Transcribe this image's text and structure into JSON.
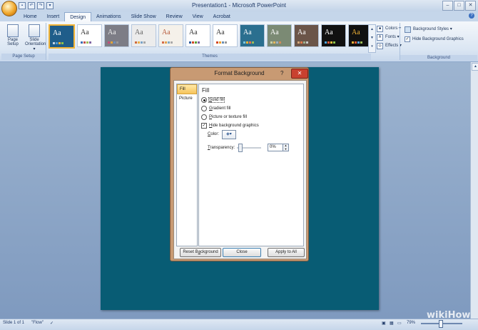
{
  "window": {
    "title": "Presentation1 - Microsoft PowerPoint"
  },
  "qat": {
    "save_icon": "save-icon",
    "undo_icon": "undo-icon",
    "redo_icon": "redo-icon",
    "customize_icon": "customize-qat-icon"
  },
  "window_controls": {
    "minimize": "–",
    "maximize": "□",
    "close": "✕"
  },
  "tabs": [
    "Home",
    "Insert",
    "Design",
    "Animations",
    "Slide Show",
    "Review",
    "View",
    "Acrobat"
  ],
  "active_tab": "Design",
  "ribbon": {
    "page_setup": {
      "label": "Page Setup",
      "page_setup_btn": "Page\nSetup",
      "orientation_btn": "Slide\nOrientation ▾"
    },
    "themes": {
      "label": "Themes",
      "items": [
        {
          "text": "Aa",
          "bg": "#1f5d8a",
          "fg": "#ffffff",
          "dots": [
            "#c2d2e4",
            "#4f9bd6",
            "#f2b437",
            "#8bc34a"
          ]
        },
        {
          "text": "Aa",
          "bg": "#ffffff",
          "fg": "#333333",
          "dots": [
            "#3b6fb6",
            "#c0504d",
            "#9bbb59",
            "#8064a2"
          ]
        },
        {
          "text": "Aa",
          "bg": "#7d7d86",
          "fg": "#eeeeee",
          "dots": [
            "#c44f7a",
            "#e0a43b",
            "#6d8fbd",
            "#999999"
          ]
        },
        {
          "text": "Aa",
          "bg": "#ececec",
          "fg": "#666666",
          "dots": [
            "#d06a3a",
            "#e8b04a",
            "#7aa3c7",
            "#a7a7a7"
          ]
        },
        {
          "text": "Aa",
          "bg": "#f5f1ea",
          "fg": "#b75b3b",
          "dots": [
            "#d46a4a",
            "#e1a34f",
            "#7ea9c5",
            "#aaaaaa"
          ]
        },
        {
          "text": "Aa",
          "bg": "#ffffff",
          "fg": "#333333",
          "dots": [
            "#2b579a",
            "#d24726",
            "#5c9c3a",
            "#8064a2"
          ]
        },
        {
          "text": "Aa",
          "bg": "#ffffff",
          "fg": "#333333",
          "dots": [
            "#d24726",
            "#f0a22e",
            "#6b8fb5",
            "#999999"
          ]
        },
        {
          "text": "Aa",
          "bg": "#2b6f8f",
          "fg": "#ffffff",
          "dots": [
            "#7cc6e0",
            "#f2b437",
            "#ef6c4a",
            "#9bbb59"
          ]
        },
        {
          "text": "Aa",
          "bg": "#7b8a74",
          "fg": "#ffffff",
          "dots": [
            "#c9d1a6",
            "#e6b85c",
            "#a0b0c0",
            "#d08a5a"
          ]
        },
        {
          "text": "Aa",
          "bg": "#6b5549",
          "fg": "#ffffff",
          "dots": [
            "#d5a77a",
            "#e07a4c",
            "#9bb08e",
            "#c9c9c9"
          ]
        },
        {
          "text": "Aa",
          "bg": "#111111",
          "fg": "#ffffff",
          "dots": [
            "#4aa3df",
            "#e05c3b",
            "#f2c23c",
            "#8bc34a"
          ]
        },
        {
          "text": "Aa",
          "bg": "#111111",
          "fg": "#f2b437",
          "dots": [
            "#f2b437",
            "#e05c3b",
            "#5aa4e0",
            "#9bbb59"
          ]
        }
      ],
      "scroll_up": "▲",
      "scroll_mid": "▼",
      "scroll_more": "▾"
    },
    "theme_options": [
      {
        "label": "Colors ▾",
        "icon": "color-swatch-icon"
      },
      {
        "label": "Fonts ▾",
        "icon": "fonts-icon"
      },
      {
        "label": "Effects ▾",
        "icon": "effects-icon"
      }
    ],
    "background": {
      "label": "Background",
      "styles_btn": "Background Styles ▾",
      "hide_graphics": "Hide Background Graphics",
      "hide_graphics_checked": "✓"
    }
  },
  "dialog": {
    "title": "Format Background",
    "help": "?",
    "close": "✕",
    "nav": [
      "Fill",
      "Picture"
    ],
    "fill": {
      "heading": "Fill",
      "options": [
        {
          "label": "Solid fill",
          "key": "S",
          "rest": "olid fill",
          "selected": true
        },
        {
          "label": "Gradient fill",
          "key": "G",
          "rest": "radient fill",
          "selected": false
        },
        {
          "label": "Picture or texture fill",
          "key": "P",
          "rest": "icture or texture fill",
          "selected": false
        }
      ],
      "hide_graphics": {
        "key": "H",
        "rest": "ide background graphics",
        "checked": "✓"
      },
      "color_label_key": "C",
      "color_label_rest": "olor:",
      "transparency_label_key": "T",
      "transparency_label_rest": "ransparency:",
      "transparency_value": "0%"
    },
    "buttons": {
      "reset_key": "Reset B",
      "reset_mid": "a",
      "reset_rest": "ckground",
      "close": "Close",
      "apply": "Apply to All"
    }
  },
  "status": {
    "slide": "Slide 1 of 1",
    "theme": "\"Flow\"",
    "zoom": "79%"
  },
  "watermark": "wikiHow",
  "colors": {
    "slide_bg": "#085c74",
    "dialog_frame": "#c89a73",
    "close_red": "#c9412f"
  }
}
